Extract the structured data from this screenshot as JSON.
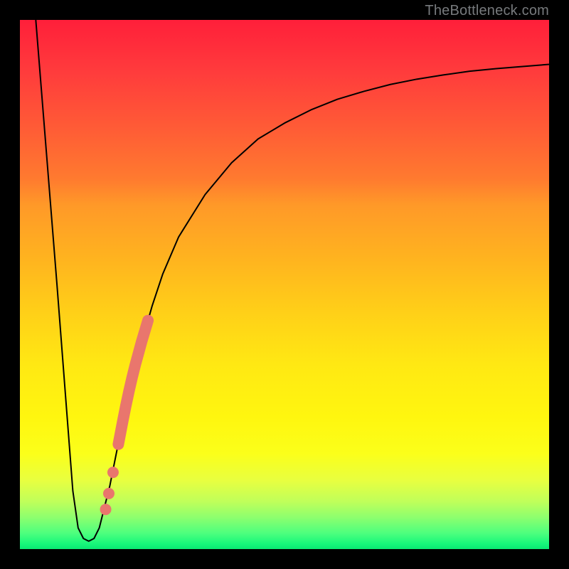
{
  "watermark": "TheBottleneck.com",
  "chart_data": {
    "type": "line",
    "title": "",
    "xlabel": "",
    "ylabel": "",
    "xlim": [
      0,
      100
    ],
    "ylim": [
      0,
      100
    ],
    "grid": false,
    "background_gradient": {
      "top": "#ff1f3a",
      "mid": "#ffe813",
      "bottom": "#17f77a"
    },
    "series": [
      {
        "name": "bottleneck-curve",
        "color": "#000000",
        "x": [
          3,
          5,
          7,
          9,
          10,
          11,
          12,
          13,
          14,
          15,
          17,
          19,
          21,
          23,
          25,
          27,
          30,
          35,
          40,
          45,
          50,
          55,
          60,
          65,
          70,
          75,
          80,
          85,
          90,
          95,
          100
        ],
        "y": [
          100,
          75,
          50,
          24,
          11,
          4,
          2,
          1.5,
          2,
          4,
          12,
          22,
          31,
          39,
          46,
          52,
          59,
          67,
          73,
          77.5,
          80.5,
          83,
          85,
          86.5,
          87.8,
          88.8,
          89.6,
          90.3,
          90.8,
          91.2,
          91.6
        ]
      }
    ],
    "scatter": {
      "name": "highlighted-points",
      "color": "#e9766d",
      "points": [
        {
          "x": 16.2,
          "y": 7.5
        },
        {
          "x": 16.8,
          "y": 10.5
        },
        {
          "x": 17.6,
          "y": 14.5
        },
        {
          "x": 18.6,
          "y": 19.8
        },
        {
          "x": 19.4,
          "y": 24.0
        },
        {
          "x": 20.0,
          "y": 27.0
        },
        {
          "x": 20.6,
          "y": 29.8
        },
        {
          "x": 21.2,
          "y": 32.4
        },
        {
          "x": 21.8,
          "y": 34.8
        },
        {
          "x": 22.4,
          "y": 37.0
        },
        {
          "x": 23.0,
          "y": 39.2
        },
        {
          "x": 23.6,
          "y": 41.2
        },
        {
          "x": 24.2,
          "y": 43.2
        }
      ]
    }
  }
}
